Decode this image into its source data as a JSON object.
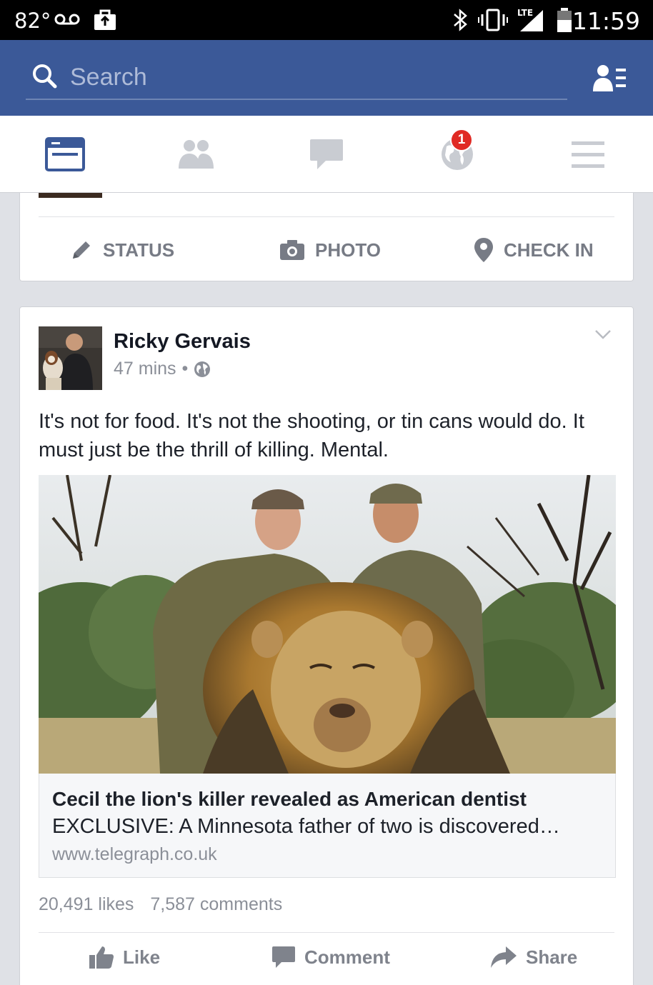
{
  "status_bar": {
    "temperature": "82°",
    "time": "11:59",
    "network": "LTE"
  },
  "search": {
    "placeholder": "Search"
  },
  "tabs": [
    {
      "name": "news-feed",
      "icon": "news-feed-icon",
      "active": true
    },
    {
      "name": "friend-requests",
      "icon": "friends-icon",
      "active": false
    },
    {
      "name": "messages",
      "icon": "chat-icon",
      "active": false
    },
    {
      "name": "notifications",
      "icon": "globe-icon",
      "active": false,
      "badge": "1"
    },
    {
      "name": "more",
      "icon": "menu-icon",
      "active": false
    }
  ],
  "composer": {
    "status_label": "STATUS",
    "photo_label": "PHOTO",
    "checkin_label": "CHECK IN"
  },
  "post": {
    "author": "Ricky Gervais",
    "time": "47 mins",
    "dot": "•",
    "text": "It's not for food. It's not the shooting, or tin cans would do. It must just be the thrill of killing. Mental.",
    "link": {
      "title": "Cecil the lion's killer revealed as American dentist",
      "description": "EXCLUSIVE: A Minnesota father of two is discovered…",
      "domain": "www.telegraph.co.uk"
    },
    "likes": "20,491 likes",
    "comments": "7,587 comments",
    "actions": {
      "like": "Like",
      "comment": "Comment",
      "share": "Share"
    }
  },
  "colors": {
    "brand_blue": "#3b5998",
    "badge_red": "#e02a24",
    "muted_gray": "#8b8f98"
  }
}
